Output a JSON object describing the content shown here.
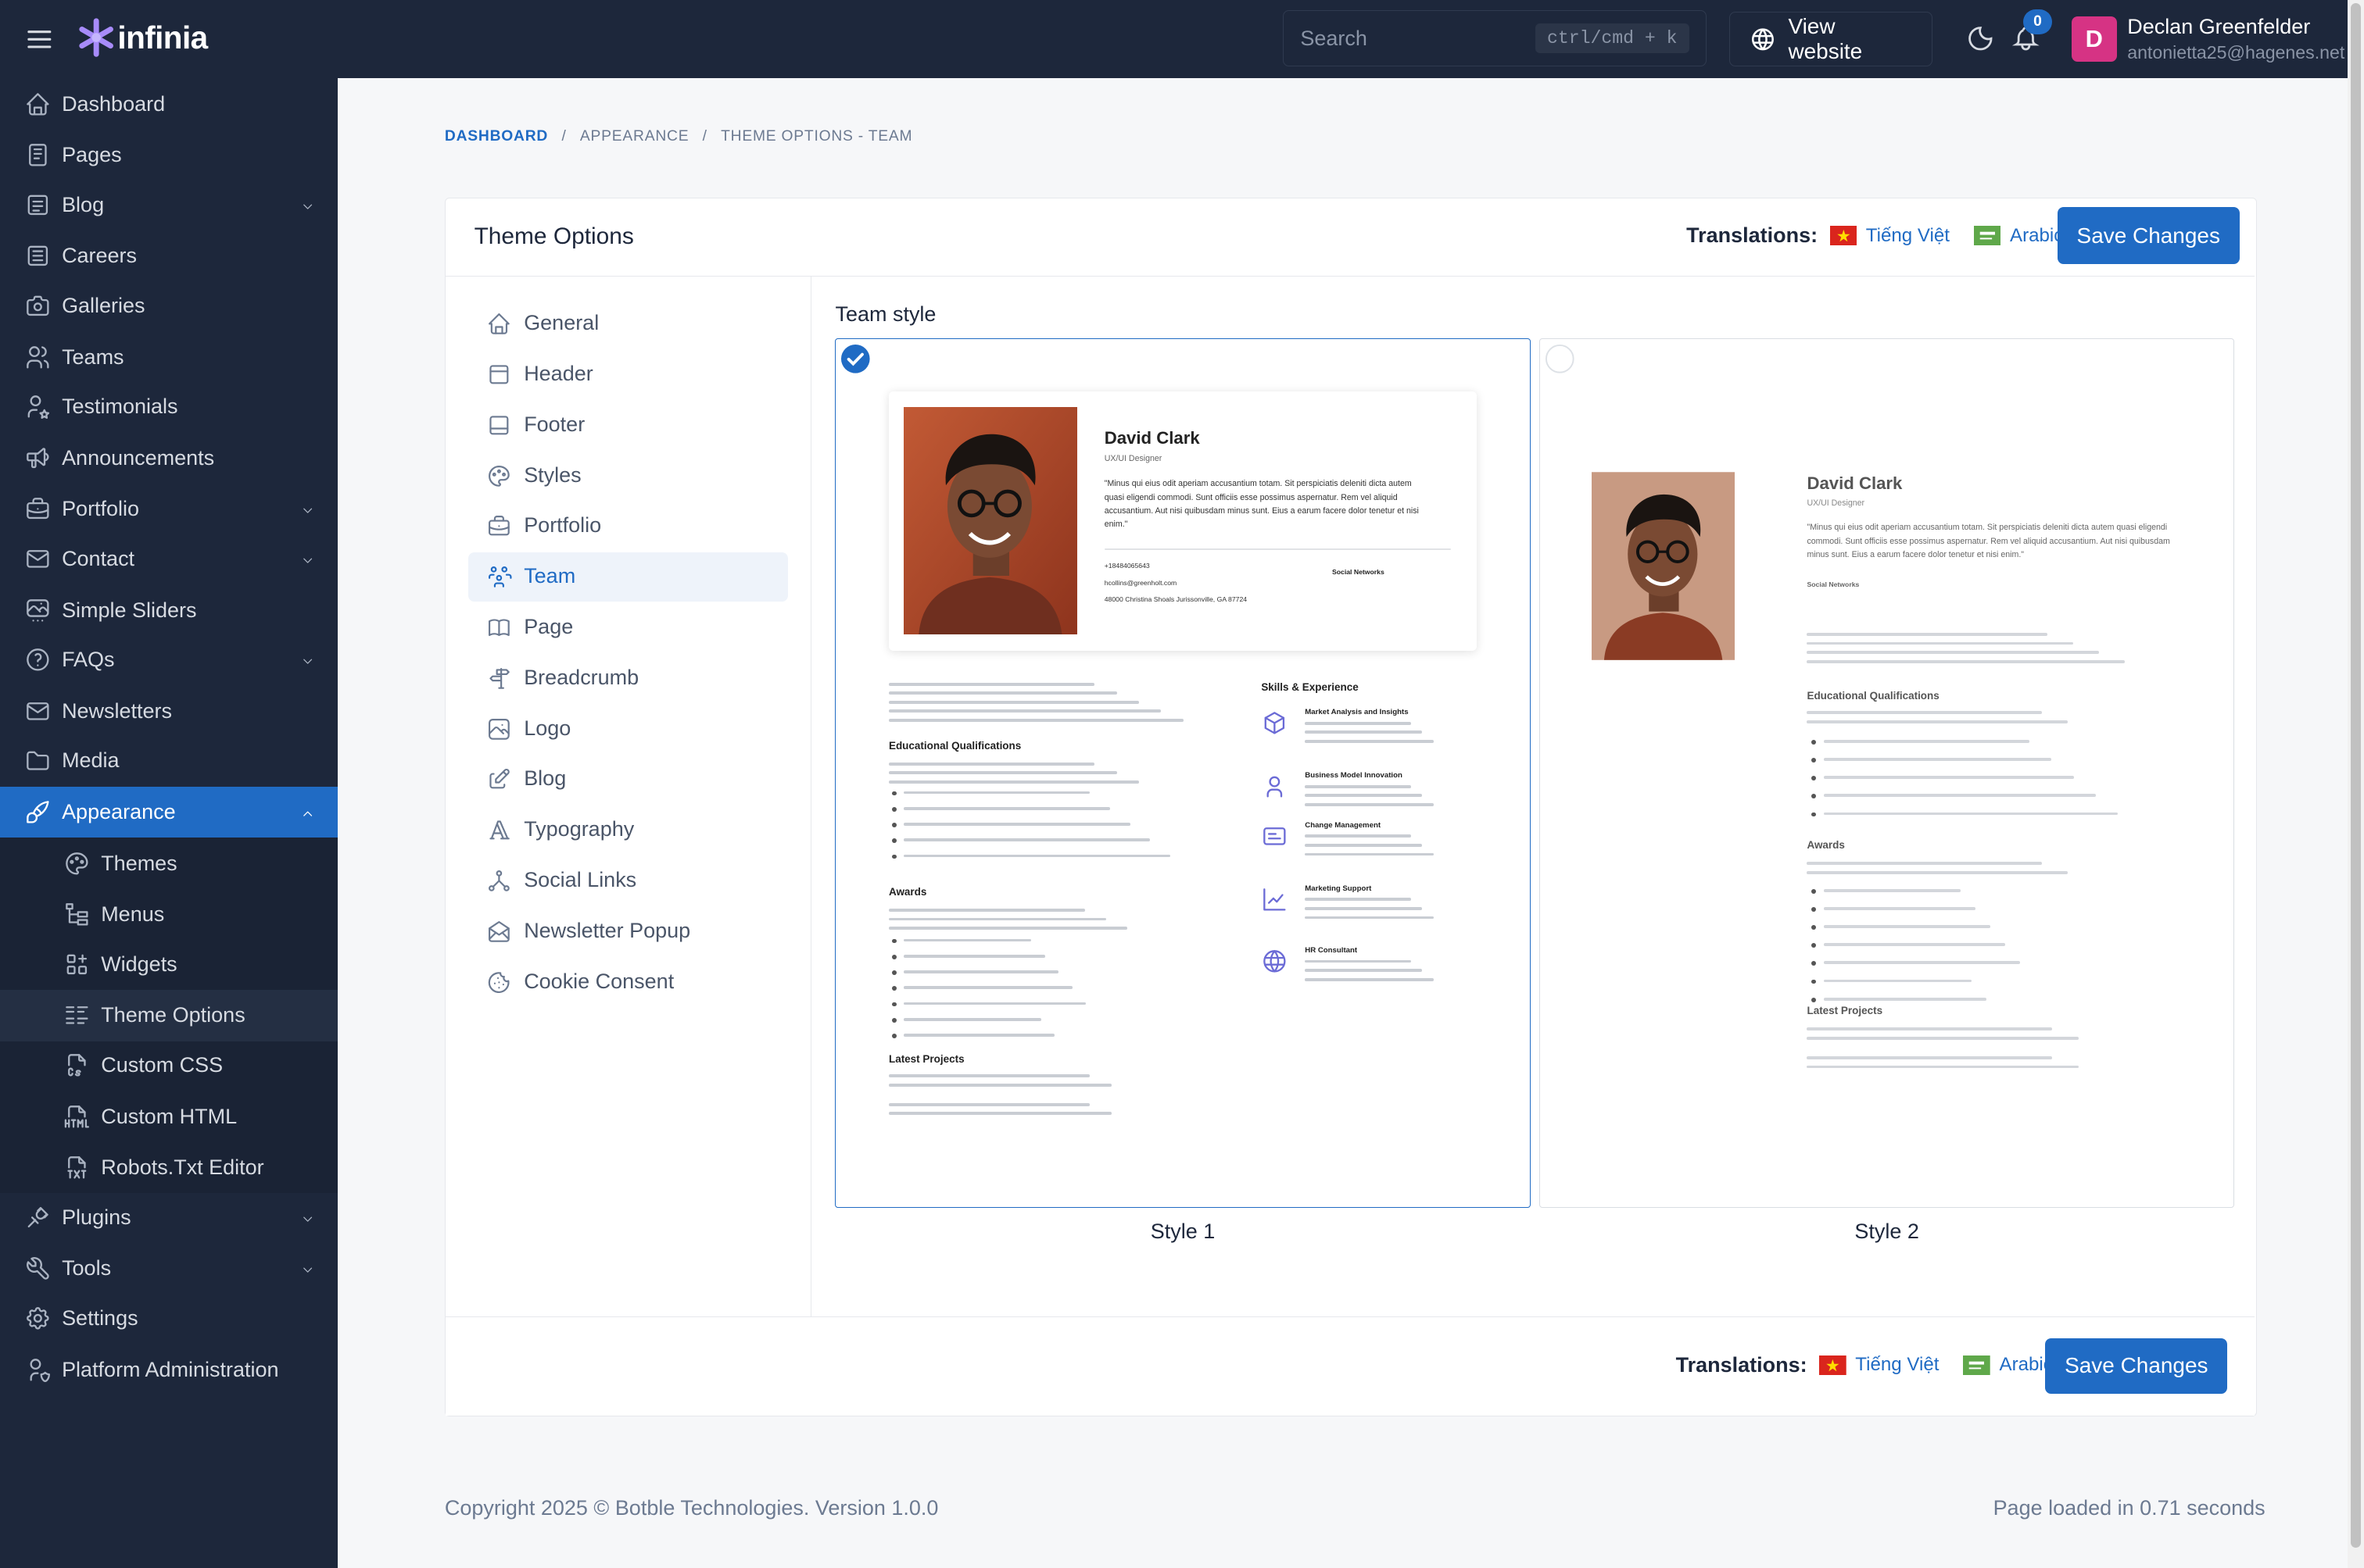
{
  "app": {
    "brand": "infinia"
  },
  "topbar": {
    "search_placeholder": "Search",
    "search_shortcut": "ctrl/cmd + k",
    "view_website": "View website",
    "notification_count": "0",
    "user_initial": "D",
    "user_name": "Declan Greenfelder",
    "user_email": "antonietta25@hagenes.net"
  },
  "sidebar": {
    "items": [
      {
        "label": "Dashboard",
        "icon": "home-icon"
      },
      {
        "label": "Pages",
        "icon": "pages-icon"
      },
      {
        "label": "Blog",
        "icon": "blog-icon",
        "expandable": true
      },
      {
        "label": "Careers",
        "icon": "careers-icon"
      },
      {
        "label": "Galleries",
        "icon": "camera-icon"
      },
      {
        "label": "Teams",
        "icon": "users-icon"
      },
      {
        "label": "Testimonials",
        "icon": "user-star-icon"
      },
      {
        "label": "Announcements",
        "icon": "speakerphone-icon"
      },
      {
        "label": "Portfolio",
        "icon": "briefcase-icon",
        "expandable": true
      },
      {
        "label": "Contact",
        "icon": "mail-icon",
        "expandable": true
      },
      {
        "label": "Simple Sliders",
        "icon": "slideshow-icon"
      },
      {
        "label": "FAQs",
        "icon": "help-icon",
        "expandable": true
      },
      {
        "label": "Newsletters",
        "icon": "mail-icon"
      },
      {
        "label": "Media",
        "icon": "folder-icon"
      },
      {
        "label": "Appearance",
        "icon": "brush-icon",
        "expandable": true,
        "active": true
      }
    ],
    "appearance_sub": [
      {
        "label": "Themes",
        "icon": "palette-icon"
      },
      {
        "label": "Menus",
        "icon": "menu-tree-icon"
      },
      {
        "label": "Widgets",
        "icon": "widgets-icon"
      },
      {
        "label": "Theme Options",
        "icon": "list-details-icon",
        "current": true
      },
      {
        "label": "Custom CSS",
        "icon": "file-css-icon"
      },
      {
        "label": "Custom HTML",
        "icon": "file-html-icon"
      },
      {
        "label": "Robots.Txt Editor",
        "icon": "file-txt-icon"
      }
    ],
    "bottom_items": [
      {
        "label": "Plugins",
        "icon": "plug-icon",
        "expandable": true
      },
      {
        "label": "Tools",
        "icon": "tool-icon",
        "expandable": true
      },
      {
        "label": "Settings",
        "icon": "settings-icon"
      },
      {
        "label": "Platform Administration",
        "icon": "user-shield-icon"
      }
    ]
  },
  "breadcrumb": [
    "DASHBOARD",
    "APPEARANCE",
    "THEME OPTIONS - TEAM"
  ],
  "card": {
    "title": "Theme Options",
    "translations_label": "Translations:",
    "languages": [
      "Tiếng Việt",
      "Arabic"
    ],
    "save_label": "Save Changes"
  },
  "options_menu": [
    {
      "label": "General",
      "icon": "home-icon"
    },
    {
      "label": "Header",
      "icon": "layout-navbar-icon"
    },
    {
      "label": "Footer",
      "icon": "layout-bottombar-icon"
    },
    {
      "label": "Styles",
      "icon": "palette-icon"
    },
    {
      "label": "Portfolio",
      "icon": "briefcase-icon"
    },
    {
      "label": "Team",
      "icon": "users-group-icon",
      "active": true
    },
    {
      "label": "Page",
      "icon": "book-icon"
    },
    {
      "label": "Breadcrumb",
      "icon": "signpost-icon"
    },
    {
      "label": "Logo",
      "icon": "photo-icon"
    },
    {
      "label": "Blog",
      "icon": "edit-icon"
    },
    {
      "label": "Typography",
      "icon": "typography-icon"
    },
    {
      "label": "Social Links",
      "icon": "share-icon"
    },
    {
      "label": "Newsletter Popup",
      "icon": "mail-opened-icon"
    },
    {
      "label": "Cookie Consent",
      "icon": "cookie-icon"
    }
  ],
  "team_style": {
    "label": "Team style",
    "options": [
      {
        "caption": "Style 1",
        "selected": true
      },
      {
        "caption": "Style 2",
        "selected": false
      }
    ]
  },
  "preview": {
    "name": "David Clark",
    "role": "UX/UI Designer",
    "quote": "\"Minus qui eius odit aperiam accusantium totam. Sit perspiciatis deleniti dicta autem quasi eligendi commodi. Sunt officiis esse possimus aspernatur. Rem vel aliquid accusantium. Aut nisi quibusdam minus sunt. Eius a earum facere dolor tenetur et nisi enim.\"",
    "phone": "+18484065643",
    "email": "hcollins@greenholt.com",
    "address": "48000 Christina Shoals Jurissonville, GA 87724",
    "social_networks": "Social Networks",
    "skills_title": "Skills & Experience",
    "skills": [
      {
        "title": "Market Analysis and Insights",
        "icon": "analysis-icon"
      },
      {
        "title": "Business Model Innovation",
        "icon": "innovation-icon"
      },
      {
        "title": "Change Management",
        "icon": "change-icon"
      },
      {
        "title": "Marketing Support",
        "icon": "chart-icon"
      },
      {
        "title": "HR Consultant",
        "icon": "globe-icon"
      }
    ],
    "edu_title": "Educational Qualifications",
    "awards_title": "Awards",
    "projects_title": "Latest Projects"
  },
  "footer": {
    "copyright": "Copyright 2025 © Botble Technologies. Version 1.0.0",
    "loaded": "Page loaded in 0.71 seconds"
  },
  "colors": {
    "primary": "#206bc4",
    "sidebar": "#1d273b",
    "avatar": "#d63384"
  }
}
